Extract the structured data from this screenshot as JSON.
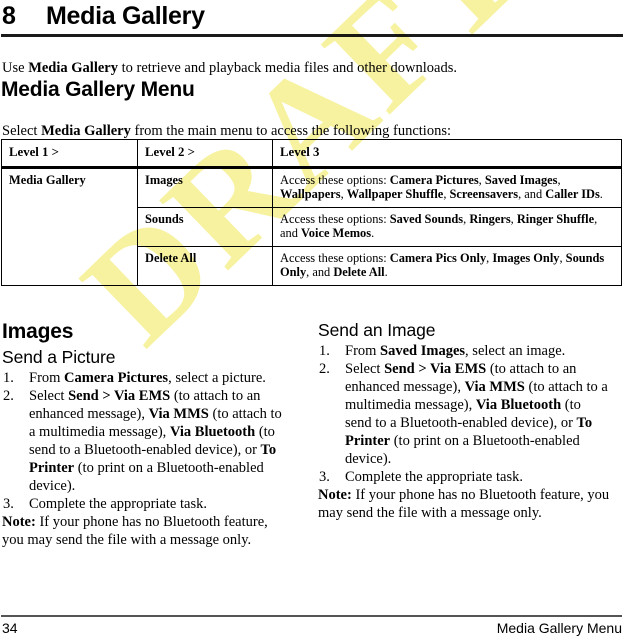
{
  "document": {
    "chapter_number": "8",
    "chapter_title": "Media Gallery",
    "watermark_text": "DRAFT",
    "watermark_color": "#f7f2a0"
  },
  "intro": {
    "text_before": "Use ",
    "bold_term": "Media Gallery",
    "text_after": " to retrieve and playback media files and other downloads."
  },
  "section_menu": {
    "heading": "Media Gallery Menu",
    "lead_before": "Select ",
    "lead_bold": "Media Gallery",
    "lead_after": " from the main menu to access the following functions:"
  },
  "table": {
    "headers": [
      "Level 1 >",
      "Level 2 >",
      "Level 3"
    ],
    "level1": "Media Gallery",
    "rows": [
      {
        "level2": "Images",
        "level3_lead": "Access these options: ",
        "level3_parts": [
          {
            "text": "Camera Pictures",
            "bold": true
          },
          {
            "text": ", ",
            "bold": false
          },
          {
            "text": "Saved Images",
            "bold": true
          },
          {
            "text": ", ",
            "bold": false
          },
          {
            "text": "Wallpapers",
            "bold": true
          },
          {
            "text": ", ",
            "bold": false
          },
          {
            "text": "Wallpaper Shuffle",
            "bold": true
          },
          {
            "text": ", ",
            "bold": false
          },
          {
            "text": "Screensavers",
            "bold": true
          },
          {
            "text": ", and ",
            "bold": false
          },
          {
            "text": "Caller IDs",
            "bold": true
          },
          {
            "text": ".",
            "bold": false
          }
        ]
      },
      {
        "level2": "Sounds",
        "level3_lead": "Access these options: ",
        "level3_parts": [
          {
            "text": "Saved Sounds",
            "bold": true
          },
          {
            "text": ", ",
            "bold": false
          },
          {
            "text": "Ringers",
            "bold": true
          },
          {
            "text": ", ",
            "bold": false
          },
          {
            "text": "Ringer Shuffle",
            "bold": true
          },
          {
            "text": ", and ",
            "bold": false
          },
          {
            "text": "Voice Memos",
            "bold": true
          },
          {
            "text": ".",
            "bold": false
          }
        ]
      },
      {
        "level2": "Delete All",
        "level3_lead": "Access these options: ",
        "level3_parts": [
          {
            "text": "Camera Pics Only",
            "bold": true
          },
          {
            "text": ", ",
            "bold": false
          },
          {
            "text": "Images Only",
            "bold": true
          },
          {
            "text": ", ",
            "bold": false
          },
          {
            "text": "Sounds Only",
            "bold": true
          },
          {
            "text": ", and ",
            "bold": false
          },
          {
            "text": "Delete All",
            "bold": true
          },
          {
            "text": ".",
            "bold": false
          }
        ]
      }
    ]
  },
  "images_section": {
    "heading": "Images",
    "left": {
      "subheading": "Send a Picture",
      "steps": [
        {
          "num": "1.",
          "parts": [
            {
              "text": "From ",
              "bold": false
            },
            {
              "text": "Camera Pictures",
              "bold": true
            },
            {
              "text": ", select a picture.",
              "bold": false
            }
          ]
        },
        {
          "num": "2.",
          "parts": [
            {
              "text": "Select ",
              "bold": false
            },
            {
              "text": "Send > Via EMS",
              "bold": true
            },
            {
              "text": " (to attach to an enhanced message), ",
              "bold": false
            },
            {
              "text": "Via MMS",
              "bold": true
            },
            {
              "text": " (to attach to a multimedia message), ",
              "bold": false
            },
            {
              "text": "Via Bluetooth",
              "bold": true
            },
            {
              "text": " (to send to a Bluetooth-enabled device), or ",
              "bold": false
            },
            {
              "text": "To Printer",
              "bold": true
            },
            {
              "text": " (to print on a Bluetooth-enabled device).",
              "bold": false
            }
          ]
        },
        {
          "num": "3.",
          "parts": [
            {
              "text": "Complete the appropriate task.",
              "bold": false
            }
          ]
        }
      ],
      "note_label": "Note:",
      "note_text": " If your phone has no Bluetooth feature, you may send the file with a message only."
    },
    "right": {
      "subheading": "Send an Image",
      "steps": [
        {
          "num": "1.",
          "parts": [
            {
              "text": "From ",
              "bold": false
            },
            {
              "text": "Saved Images",
              "bold": true
            },
            {
              "text": ", select an image.",
              "bold": false
            }
          ]
        },
        {
          "num": "2.",
          "parts": [
            {
              "text": "Select ",
              "bold": false
            },
            {
              "text": "Send > Via EMS",
              "bold": true
            },
            {
              "text": " (to attach to an enhanced message), ",
              "bold": false
            },
            {
              "text": "Via MMS",
              "bold": true
            },
            {
              "text": " (to attach to a multimedia message), ",
              "bold": false
            },
            {
              "text": "Via Bluetooth",
              "bold": true
            },
            {
              "text": " (to send to a Bluetooth-enabled device), or ",
              "bold": false
            },
            {
              "text": "To Printer",
              "bold": true
            },
            {
              "text": " (to print on a Bluetooth-enabled device).",
              "bold": false
            }
          ]
        },
        {
          "num": "3.",
          "parts": [
            {
              "text": "Complete the appropriate task.",
              "bold": false
            }
          ]
        }
      ],
      "note_label": "Note:",
      "note_text": " If your phone has no Bluetooth feature, you may send the file with a message only."
    }
  },
  "footer": {
    "page_number": "34",
    "running_head": "Media Gallery Menu"
  }
}
